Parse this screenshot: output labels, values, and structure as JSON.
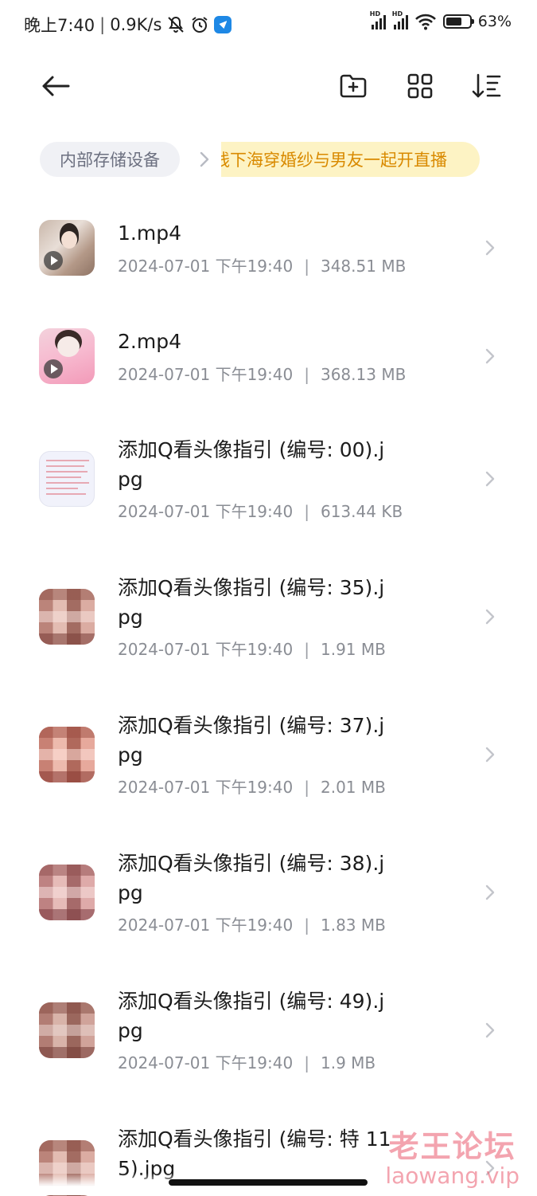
{
  "status_bar": {
    "time": "晚上7:40",
    "net_speed": "0.9K/s",
    "sim1_label": "HD",
    "sim2_label": "HD",
    "battery": "63%",
    "icons": [
      "mute-icon",
      "alarm-icon",
      "app-notification-icon",
      "signal-icon",
      "wifi-icon",
      "battery-icon"
    ]
  },
  "toolbar": {
    "back": "back-arrow-icon",
    "new_folder": "new-folder-icon",
    "grid_view": "grid-view-icon",
    "sort": "sort-icon"
  },
  "breadcrumb": {
    "root": "内部存储设备",
    "current": "线下海穿婚纱与男友一起开直播"
  },
  "files": [
    {
      "name": "1.mp4",
      "date": "2024-07-01 下午19:40",
      "size": "348.51 MB",
      "type": "video"
    },
    {
      "name": "2.mp4",
      "date": "2024-07-01 下午19:40",
      "size": "368.13 MB",
      "type": "video"
    },
    {
      "name": "添加Q看头像指引 (编号: 00).jpg",
      "date": "2024-07-01 下午19:40",
      "size": "613.44 KB",
      "type": "image"
    },
    {
      "name": "添加Q看头像指引 (编号: 35).jpg",
      "date": "2024-07-01 下午19:40",
      "size": "1.91 MB",
      "type": "image"
    },
    {
      "name": "添加Q看头像指引 (编号: 37).jpg",
      "date": "2024-07-01 下午19:40",
      "size": "2.01 MB",
      "type": "image"
    },
    {
      "name": "添加Q看头像指引 (编号: 38).jpg",
      "date": "2024-07-01 下午19:40",
      "size": "1.83 MB",
      "type": "image"
    },
    {
      "name": "添加Q看头像指引 (编号: 49).jpg",
      "date": "2024-07-01 下午19:40",
      "size": "1.9 MB",
      "type": "image"
    },
    {
      "name": "添加Q看头像指引 (编号: 特 115).jpg",
      "date": "",
      "size": "",
      "type": "image"
    }
  ],
  "watermark": {
    "title": "老王论坛",
    "url": "laowang.vip"
  },
  "colors": {
    "breadcrumb_current_bg": "#fdf3c4",
    "breadcrumb_current_text": "#d98a00",
    "meta_text": "#8a8d94",
    "watermark": "#ea5a6e"
  }
}
